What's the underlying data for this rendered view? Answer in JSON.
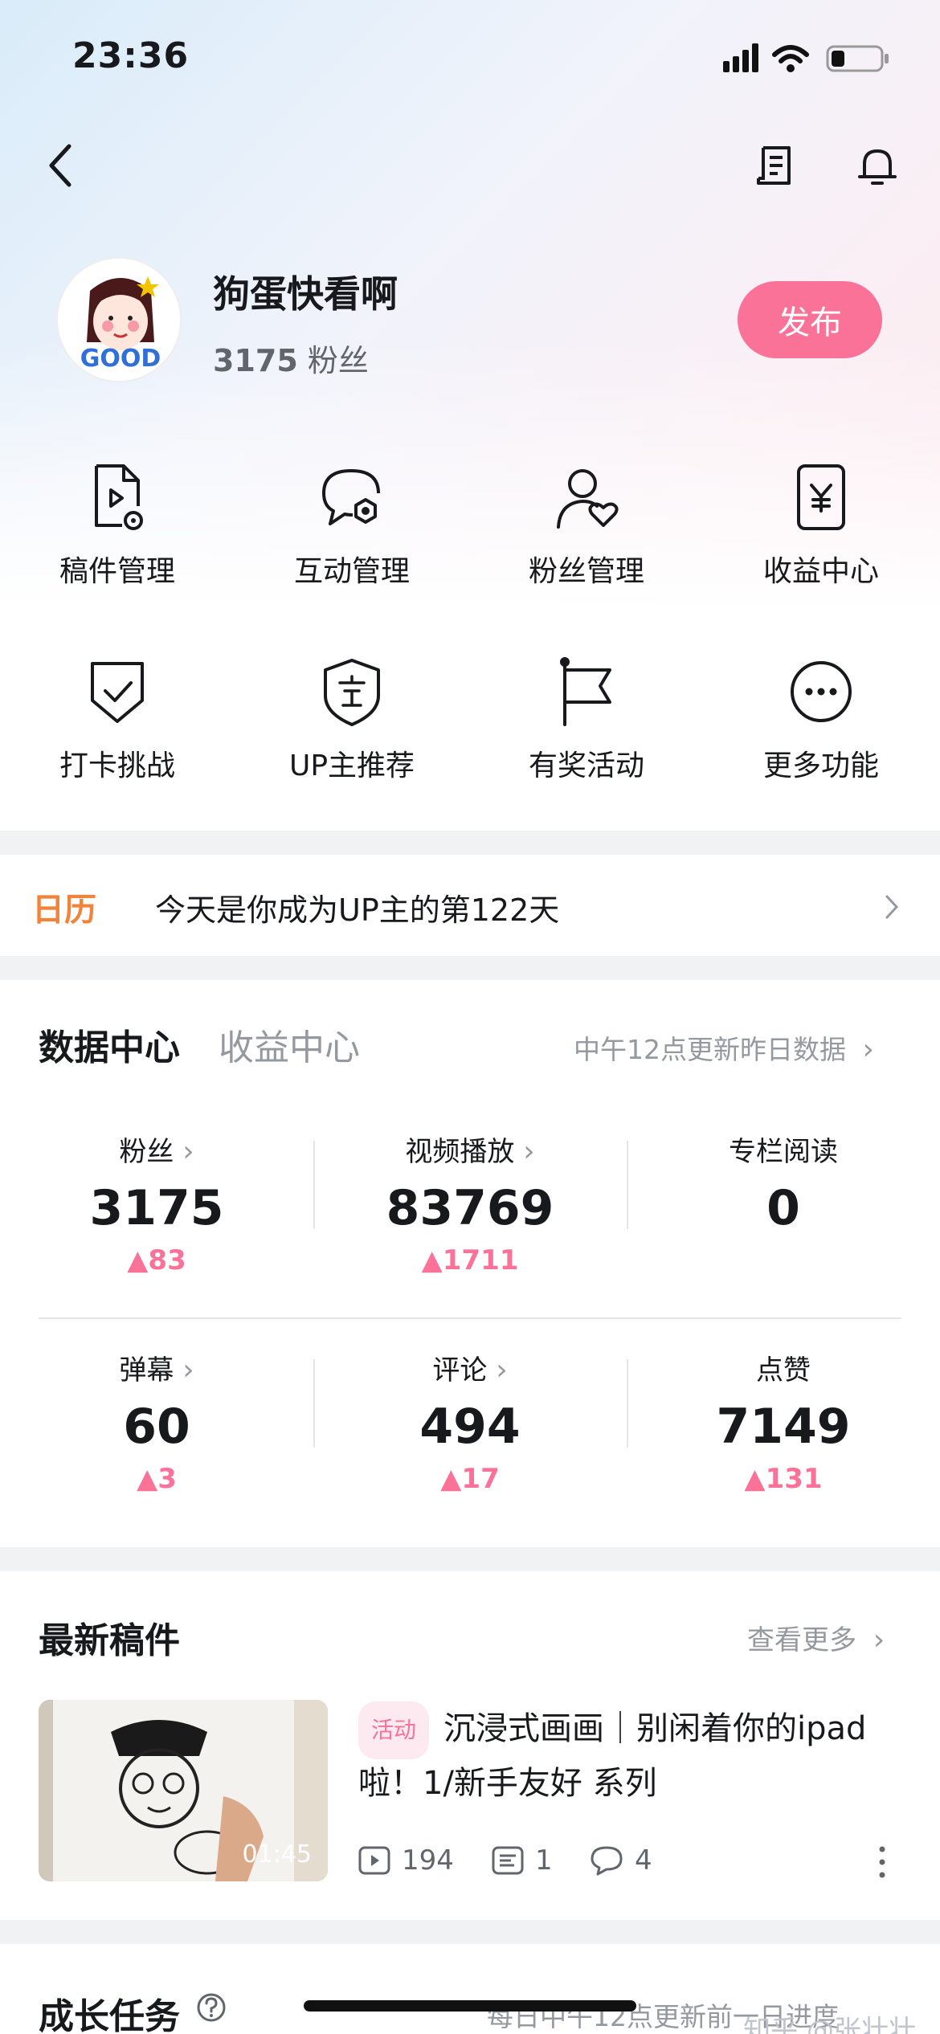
{
  "status_bar": {
    "time": "23:36"
  },
  "profile": {
    "name": "狗蛋快看啊",
    "fans_count": "3175",
    "fans_label": "粉丝",
    "publish_label": "发布",
    "avatar_text": "GOOD"
  },
  "quick_actions": [
    {
      "label": "稿件管理",
      "icon": "document-play-icon"
    },
    {
      "label": "互动管理",
      "icon": "chat-gear-icon"
    },
    {
      "label": "粉丝管理",
      "icon": "user-heart-icon"
    },
    {
      "label": "收益中心",
      "icon": "yen-card-icon"
    },
    {
      "label": "打卡挑战",
      "icon": "shield-check-icon"
    },
    {
      "label": "UP主推荐",
      "icon": "award-badge-icon"
    },
    {
      "label": "有奖活动",
      "icon": "flag-icon"
    },
    {
      "label": "更多功能",
      "icon": "more-dots-icon"
    }
  ],
  "calendar": {
    "label": "日历",
    "text": "今天是你成为UP主的第122天"
  },
  "data_center": {
    "tab_active": "数据中心",
    "tab_inactive": "收益中心",
    "update_note": "中午12点更新昨日数据",
    "stats": [
      {
        "label": "粉丝",
        "value": "3175",
        "delta": "83",
        "chevron": true
      },
      {
        "label": "视频播放",
        "value": "83769",
        "delta": "1711",
        "chevron": true
      },
      {
        "label": "专栏阅读",
        "value": "0",
        "delta": "",
        "chevron": false
      },
      {
        "label": "弹幕",
        "value": "60",
        "delta": "3",
        "chevron": true
      },
      {
        "label": "评论",
        "value": "494",
        "delta": "17",
        "chevron": true
      },
      {
        "label": "点赞",
        "value": "7149",
        "delta": "131",
        "chevron": false
      }
    ]
  },
  "latest": {
    "title": "最新稿件",
    "more": "查看更多",
    "video": {
      "tag": "活动",
      "title": "沉浸式画画｜别闲着你的ipad啦！1/新手友好 系列",
      "duration": "01:45",
      "plays": "194",
      "danmaku": "1",
      "comments": "4"
    }
  },
  "growth": {
    "title": "成长任务",
    "note": "每日中午12点更新前一日进度"
  },
  "watermark": "知乎 @张壮壮",
  "colors": {
    "accent": "#fb7299",
    "calendar": "#f2833a"
  }
}
